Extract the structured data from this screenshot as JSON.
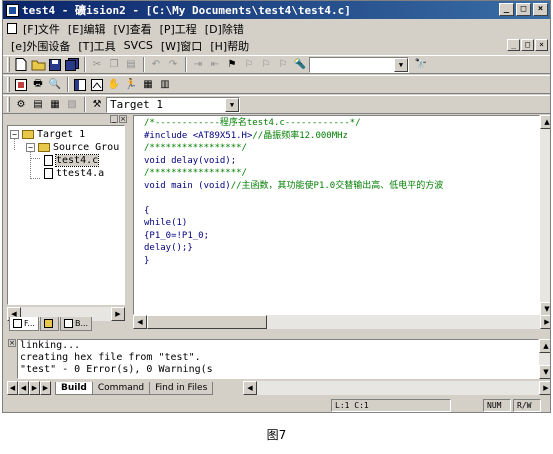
{
  "window": {
    "title": "test4  - 礦ision2 - [C:\\My Documents\\test4\\test4.c]",
    "controls": [
      "_",
      "□",
      "×"
    ]
  },
  "menu": {
    "row1": [
      "[F]文件",
      "[E]编辑",
      "[V]查看",
      "[P]工程",
      "[D]除错"
    ],
    "row2": [
      "[e]外围设备",
      "[T]工具",
      "SVCS",
      "[W]窗口",
      "[H]帮助"
    ],
    "mdi_controls": [
      "_",
      "□",
      "×"
    ]
  },
  "toolbar3": {
    "target_select": "Target 1"
  },
  "project": {
    "tree": {
      "root": "Target 1",
      "group": "Source Grou",
      "files": [
        "test4.c",
        "ttest4.a"
      ]
    },
    "tabs": [
      "F...",
      "",
      "B..."
    ]
  },
  "editor": {
    "lines": [
      {
        "text": "/*------------程序名test4.c------------*/",
        "color": "#007f00"
      },
      {
        "text": "#include <AT89X51.H>//晶振频率12.000MHz",
        "color": "#00007f",
        "comment": "//晶振频率12.000MHz",
        "comment_color": "#007f00"
      },
      {
        "text": "/*****************/",
        "color": "#007f00"
      },
      {
        "text": "void delay(void);",
        "color": "#00007f"
      },
      {
        "text": "/*****************/",
        "color": "#007f00"
      },
      {
        "text": "void main (void)//主函数，其功能使P1.0交替输出高、低电平的方波",
        "color": "#00007f",
        "comment": "//主函数，其功能使P1.0交替输出高、低电平的方波",
        "comment_color": "#007f00"
      },
      {
        "text": "",
        "color": "#000000"
      },
      {
        "text": "{",
        "color": "#00007f"
      },
      {
        "text": "while(1)",
        "color": "#00007f"
      },
      {
        "text": "{P1_0=!P1_0;",
        "color": "#00007f"
      },
      {
        "text": "delay();}",
        "color": "#00007f"
      },
      {
        "text": "}",
        "color": "#00007f"
      }
    ]
  },
  "output": {
    "lines": [
      "linking...",
      "creating hex file from \"test\".",
      "\"test\" - 0 Error(s), 0 Warning(s"
    ],
    "tabs": [
      "Build",
      "Command",
      "Find in Files"
    ]
  },
  "status": {
    "position": "L:1 C:1",
    "mode": "NUM",
    "access": "R/W"
  },
  "caption": "图7"
}
